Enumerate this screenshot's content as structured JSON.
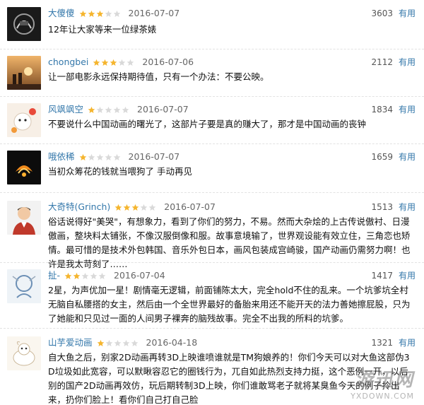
{
  "comments": [
    {
      "username": "大傻傻",
      "rating": 3,
      "date": "2016-07-07",
      "votes": "3603",
      "useful_label": "有用",
      "text": "12年让大家等来一位绿茶婊"
    },
    {
      "username": "chongbei",
      "rating": 3,
      "date": "2016-07-06",
      "votes": "2112",
      "useful_label": "有用",
      "text": "让一部电影永远保持期待值，只有一个办法：不要公映。"
    },
    {
      "username": "风飒飒空",
      "rating": 1,
      "date": "2016-07-07",
      "votes": "1834",
      "useful_label": "有用",
      "text": "不要说什么中国动画的曙光了，这部片子要是真的赚大了，那才是中国动画的丧钟"
    },
    {
      "username": "哦依稀",
      "rating": 1,
      "date": "2016-07-07",
      "votes": "1659",
      "useful_label": "有用",
      "text": "当初众筹花的钱就当喂狗了 手动再见"
    },
    {
      "username": "大奇特(Grinch)",
      "rating": 3,
      "date": "2016-07-07",
      "votes": "1513",
      "useful_label": "有用",
      "text": "俗话说得好\"美哭\"，有想象力，看到了你们的努力，不易。然而大杂烩的上古传说傲衬、日漫傲画，整块料太铺张，不像汉服倒像和服。故事意境输了，世界观设能有效立住，三角恋也矫情。最可惜的是技术外包韩国、音乐外包日本，画风包装成宫崎骏，国产动画仍需努力啊！也许是我太苛刻了……"
    },
    {
      "username": "扯-",
      "rating": 2,
      "date": "2016-07-04",
      "votes": "1417",
      "useful_label": "有用",
      "text": "2星，为声优加一星！剧情毫无逻辑，前面铺陈太大，完全hold不住的乱来。一个坑爹坑全村无脑自私腰搭的女主，然后由一个全世界最好的备胎来用还不能开天的法力善她擦屁股，只为了她能和只见过一面的人间男子裸奔的脑残故事。完全不出我的所料的坑爹。"
    },
    {
      "username": "山芋爱动画",
      "rating": 1,
      "date": "2016-04-18",
      "votes": "1321",
      "useful_label": "有用",
      "text": "自大鱼之后，别家2D动画再转3D上映谁喷谁就是TM狗娘养的！你们今天可以对大鱼这部伪3D垃圾如此宽容，可以默瞅容忍它的圈钱行为，兀自如此热烈支持力挺，这个恶例一开，以后别的国产2D动画再效仿，玩后期转制3D上映，你们谁敢骂老子就将某臭鱼今天的例子拎出来，扔你们脸上！看你们自己打自己脸"
    }
  ],
  "watermark": {
    "main": "游迅网",
    "sub": "YXDOWN.COM"
  },
  "colors": {
    "link": "#3377aa",
    "star_on": "#f5b52e",
    "star_off": "#d9d9d9"
  }
}
